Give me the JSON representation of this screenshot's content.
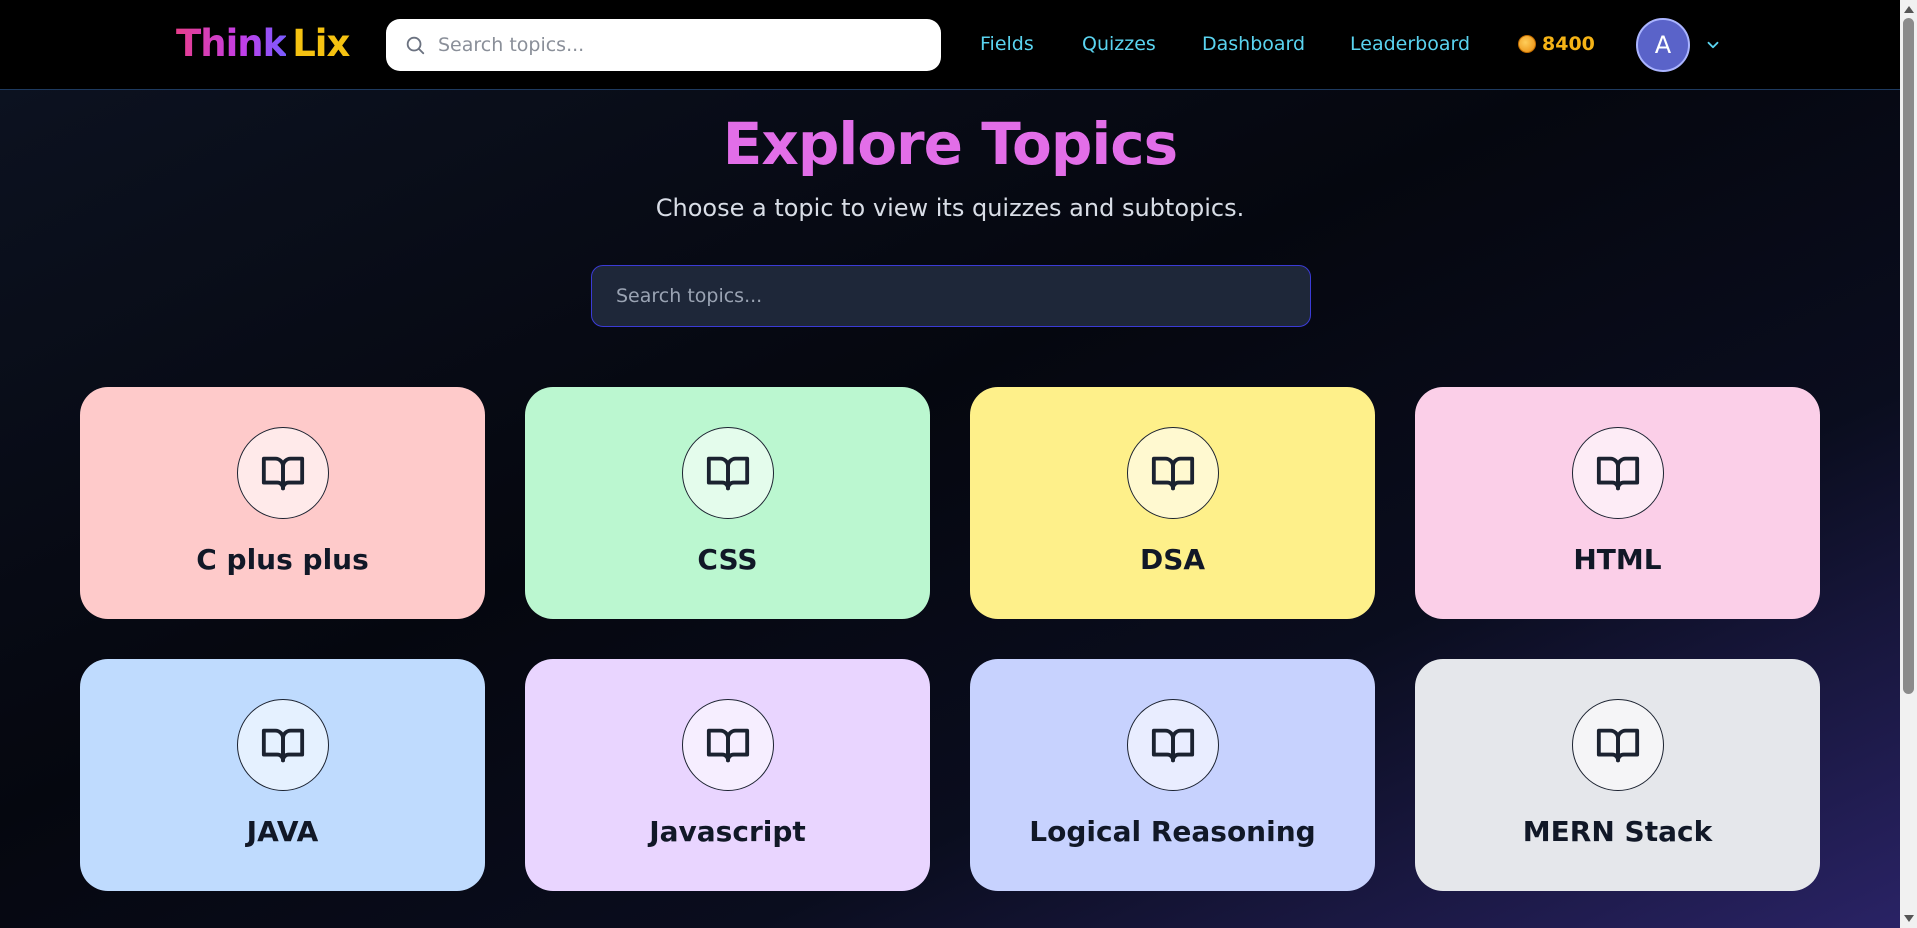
{
  "brand": {
    "part1": "Think",
    "part2": "Lix"
  },
  "nav": {
    "search_placeholder": "Search topics...",
    "links": [
      "Fields",
      "Quizzes",
      "Dashboard",
      "Leaderboard"
    ],
    "coins": "8400",
    "avatar_initial": "A"
  },
  "hero": {
    "title": "Explore Topics",
    "subtitle": "Choose a topic to view its quizzes and subtopics.",
    "search_placeholder": "Search topics..."
  },
  "topics": [
    {
      "label": "C plus plus",
      "color": "#fecaca"
    },
    {
      "label": "CSS",
      "color": "#bbf7d0"
    },
    {
      "label": "DSA",
      "color": "#fef08a"
    },
    {
      "label": "HTML",
      "color": "#fbcfe8"
    },
    {
      "label": "JAVA",
      "color": "#bfdbfe"
    },
    {
      "label": "Javascript",
      "color": "#e9d5ff"
    },
    {
      "label": "Logical Reasoning",
      "color": "#c7d2fe"
    },
    {
      "label": "MERN Stack",
      "color": "#e5e7eb"
    }
  ],
  "icons": {
    "topic": "book-open-icon",
    "search": "search-icon",
    "coin": "coin-icon",
    "dropdown": "chevron-down-icon"
  }
}
